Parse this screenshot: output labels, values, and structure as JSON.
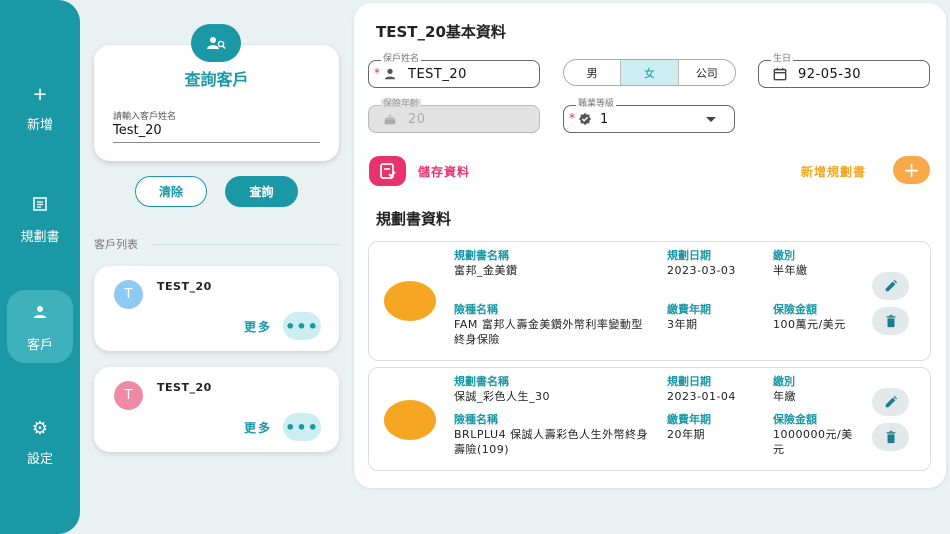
{
  "nav": {
    "items": [
      {
        "label": "新增",
        "icon": "plus-icon"
      },
      {
        "label": "規劃書",
        "icon": "document-icon"
      },
      {
        "label": "客戶",
        "icon": "person-icon"
      },
      {
        "label": "設定",
        "icon": "gear-icon"
      }
    ],
    "active": "客戶"
  },
  "search": {
    "title": "查詢客戶",
    "input_label": "請輸入客戶姓名",
    "input_value": "Test_20",
    "clear_label": "清除",
    "query_label": "查詢"
  },
  "customers": {
    "section_label": "客戶列表",
    "items": [
      {
        "initial": "T",
        "name": "TEST_20",
        "more_label": "更多",
        "avatar_color": "#8ec9f2"
      },
      {
        "initial": "T",
        "name": "TEST_20",
        "more_label": "更多",
        "avatar_color": "#ef8aa6"
      }
    ]
  },
  "detail": {
    "title": "TEST_20基本資料",
    "name_label": "保戶姓名",
    "name_value": "TEST_20",
    "gender_options": [
      "男",
      "女",
      "公司"
    ],
    "gender_selected": "女",
    "birthday_label": "生日",
    "birthday_value": "92-05-30",
    "age_label": "保險年齡",
    "age_value": "20",
    "job_label": "職業等級",
    "job_value": "1",
    "save_label": "儲存資料",
    "new_plan_label": "新增規劃書",
    "plans_title": "規劃書資料"
  },
  "plans": [
    {
      "name_h": "規劃書名稱",
      "name": "富邦_金美鑽",
      "date_h": "規劃日期",
      "date": "2023-03-03",
      "freq_h": "繳別",
      "freq": "半年繳",
      "product_h": "險種名稱",
      "product": "FAM 富邦人壽金美鑽外幣利率變動型終身保險",
      "term_h": "繳費年期",
      "term": "3年期",
      "amount_h": "保險金額",
      "amount": "100萬元/美元"
    },
    {
      "name_h": "規劃書名稱",
      "name": "保誠_彩色人生_30",
      "date_h": "規劃日期",
      "date": "2023-01-04",
      "freq_h": "繳別",
      "freq": "年繳",
      "product_h": "險種名稱",
      "product": "BRLPLU4 保誠人壽彩色人生外幣終身壽險(109)",
      "term_h": "繳費年期",
      "term": "20年期",
      "amount_h": "保險金額",
      "amount": "1000000元/美元"
    }
  ],
  "colors": {
    "brand": "#1a98a6",
    "save": "#e8336e",
    "accent": "#f5a623"
  }
}
